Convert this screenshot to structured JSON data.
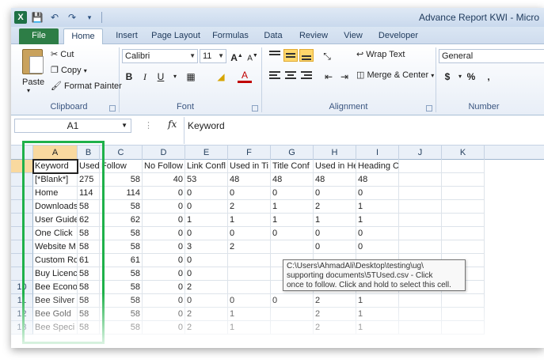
{
  "window": {
    "title": "Advance Report KWI - Micro",
    "app_icon": "X",
    "qat": {
      "save": "save-icon",
      "undo": "undo-icon",
      "redo": "redo-icon",
      "customize": "customize-icon"
    }
  },
  "tabs": [
    "File",
    "Home",
    "Insert",
    "Page Layout",
    "Formulas",
    "Data",
    "Review",
    "View",
    "Developer"
  ],
  "ribbon": {
    "clipboard": {
      "label": "Clipboard",
      "paste": "Paste",
      "cut": "Cut",
      "copy": "Copy",
      "format_painter": "Format Painter"
    },
    "font": {
      "label": "Font",
      "name": "Calibri",
      "size": "11",
      "grow": "A",
      "shrink": "A",
      "bold": "B",
      "italic": "I",
      "underline": "U"
    },
    "alignment": {
      "label": "Alignment",
      "wrap_text": "Wrap Text",
      "merge_center": "Merge & Center"
    },
    "number": {
      "label": "Number",
      "format": "General",
      "currency": "$",
      "percent": "%",
      "comma": ","
    }
  },
  "formula_bar": {
    "name_box": "A1",
    "fx": "fx",
    "value": "Keyword"
  },
  "columns": [
    "A",
    "B",
    "C",
    "D",
    "E",
    "F",
    "G",
    "H",
    "I",
    "J",
    "K"
  ],
  "rows": [
    {
      "num": "",
      "cells": [
        "Keyword",
        "Used in An",
        "Follow",
        "No Follow",
        "Link Confl",
        "Used in Ti",
        "Title Conf",
        "Used in He",
        "Heading Conflict",
        "",
        ""
      ]
    },
    {
      "num": "",
      "cells": [
        "[*Blank*]",
        "275",
        "58",
        "40",
        "53",
        "48",
        "48",
        "48",
        "48",
        "",
        ""
      ]
    },
    {
      "num": "",
      "cells": [
        "Home",
        "114",
        "114",
        "0",
        "0",
        "0",
        "0",
        "0",
        "0",
        "",
        ""
      ]
    },
    {
      "num": "",
      "cells": [
        "Downloads",
        "58",
        "58",
        "0",
        "0",
        "2",
        "1",
        "2",
        "1",
        "",
        ""
      ]
    },
    {
      "num": "",
      "cells": [
        "User Guide",
        "62",
        "62",
        "0",
        "1",
        "1",
        "1",
        "1",
        "1",
        "",
        ""
      ]
    },
    {
      "num": "",
      "cells": [
        "One Click",
        "58",
        "58",
        "0",
        "0",
        "0",
        "0",
        "0",
        "0",
        "",
        ""
      ]
    },
    {
      "num": "",
      "cells": [
        "Website M",
        "58",
        "58",
        "0",
        "3",
        "2",
        "",
        "0",
        "0",
        "",
        ""
      ]
    },
    {
      "num": "",
      "cells": [
        "Custom Ro",
        "61",
        "61",
        "0",
        "0",
        "",
        "",
        "",
        "",
        "",
        ""
      ]
    },
    {
      "num": "",
      "cells": [
        "Buy Licenc",
        "58",
        "58",
        "0",
        "0",
        "",
        "",
        "",
        "",
        "",
        ""
      ]
    },
    {
      "num": "10",
      "cells": [
        "Bee Econo",
        "58",
        "58",
        "0",
        "2",
        "",
        "",
        "",
        "",
        "",
        ""
      ]
    },
    {
      "num": "11",
      "cells": [
        "Bee Silver",
        "58",
        "58",
        "0",
        "0",
        "0",
        "0",
        "2",
        "1",
        "",
        ""
      ]
    },
    {
      "num": "12",
      "cells": [
        "Bee Gold",
        "58",
        "58",
        "0",
        "2",
        "1",
        "",
        "2",
        "1",
        "",
        ""
      ]
    },
    {
      "num": "13",
      "cells": [
        "Bee Speci",
        "58",
        "58",
        "0",
        "2",
        "1",
        "",
        "2",
        "1",
        "",
        ""
      ]
    }
  ],
  "tooltip": {
    "line1": "C:\\Users\\AhmadAli\\Desktop\\testing\\ug\\",
    "line2": "supporting documents\\5TUsed.csv - Click",
    "line3": "once to follow. Click and hold to select this cell."
  },
  "colors": {
    "highlight": "#1fb14a",
    "file_tab": "#2d7d46",
    "selected_header": "#f9d99f"
  }
}
